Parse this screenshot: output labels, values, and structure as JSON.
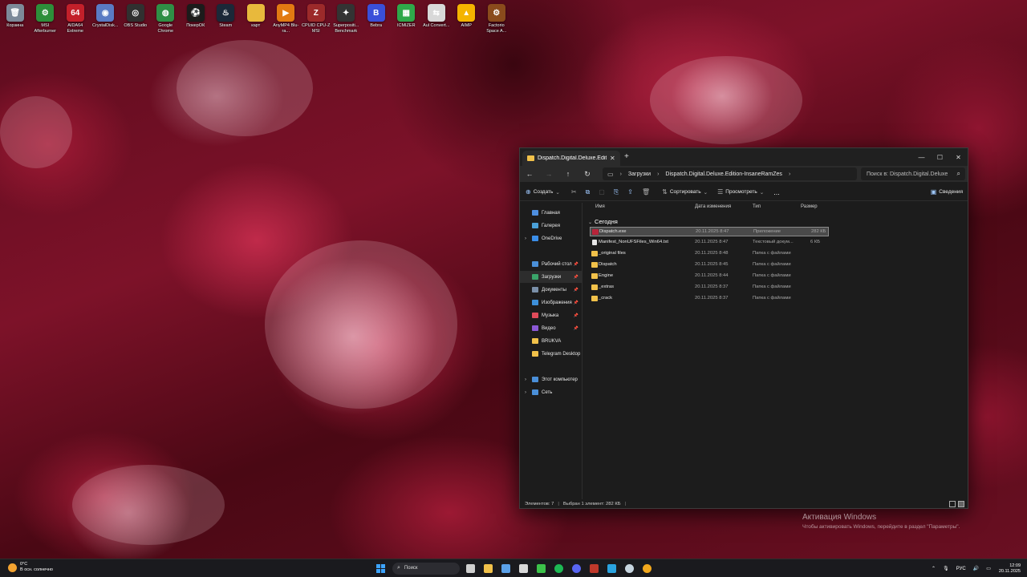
{
  "desktop": {
    "icons": [
      {
        "label": "Корзина",
        "icon": "recycle-bin-icon",
        "color": "#7d8a99",
        "glyph": "🗑"
      },
      {
        "label": "MSI Afterburner",
        "icon": "msi-afterburner-icon",
        "color": "#2d8f3a",
        "glyph": "⚙"
      },
      {
        "label": "AIDA64 Extreme",
        "icon": "aida64-icon",
        "color": "#c3202a",
        "glyph": "64"
      },
      {
        "label": "CrystalDisk...",
        "icon": "crystaldisk-icon",
        "color": "#5a7bc4",
        "glyph": "◉"
      },
      {
        "label": "OBS Studio",
        "icon": "obs-studio-icon",
        "color": "#303030",
        "glyph": "◎"
      },
      {
        "label": "Google Chrome",
        "icon": "chrome-icon",
        "color": "#2f8f46",
        "glyph": "◍"
      },
      {
        "label": "ПокерОК",
        "icon": "pokerok-icon",
        "color": "#1b1b1b",
        "glyph": "⚽"
      },
      {
        "label": "Steam",
        "icon": "steam-icon",
        "color": "#1b2838",
        "glyph": "♨"
      },
      {
        "label": "карт",
        "icon": "folder-icon",
        "color": "#e8b93c",
        "glyph": ""
      },
      {
        "label": "AnyMP4 Blu-ra...",
        "icon": "anymp4-icon",
        "color": "#e27a12",
        "glyph": "▶"
      },
      {
        "label": "CPUID CPU-Z MSI",
        "icon": "cpuz-icon",
        "color": "#9c2a2a",
        "glyph": "Z"
      },
      {
        "label": "Superpositi... Benchmark",
        "icon": "superposition-icon",
        "color": "#333333",
        "glyph": "✦"
      },
      {
        "label": "Bebra",
        "icon": "bebra-icon",
        "color": "#3a4fd9",
        "glyph": "B"
      },
      {
        "label": "ICMIZER",
        "icon": "icmizer-icon",
        "color": "#2fa84a",
        "glyph": "▦"
      },
      {
        "label": "Aul Convert...",
        "icon": "aul-convert-icon",
        "color": "#d8d8d8",
        "glyph": "⇆"
      },
      {
        "label": "AIMP",
        "icon": "aimp-icon",
        "color": "#f4b400",
        "glyph": "▲"
      },
      {
        "label": "Factorio Space A...",
        "icon": "factorio-icon",
        "color": "#8a4b1c",
        "glyph": "⚙"
      }
    ]
  },
  "explorer": {
    "tab_title": "Dispatch.Digital.Deluxe.Edition",
    "breadcrumb": [
      "Загрузки",
      "Dispatch.Digital.Deluxe.Edition-InsaneRamZes"
    ],
    "search_placeholder": "Поиск в: Dispatch.Digital.Deluxe",
    "toolbar": {
      "create": "Создать",
      "sort": "Сортировать",
      "view": "Просмотреть",
      "more": "...",
      "details": "Сведения"
    },
    "sidebar": [
      {
        "label": "Главная",
        "icon": "home-icon",
        "color": "#4e8fe0"
      },
      {
        "label": "Галерея",
        "icon": "gallery-icon",
        "color": "#4aa0d8"
      },
      {
        "label": "OneDrive",
        "icon": "onedrive-icon",
        "color": "#3b8ee8"
      },
      {
        "label": "Рабочий стол",
        "icon": "desktop-icon",
        "color": "#4a8fd8"
      },
      {
        "label": "Загрузки",
        "icon": "downloads-icon",
        "color": "#3aa46a"
      },
      {
        "label": "Документы",
        "icon": "documents-icon",
        "color": "#7a8fa8"
      },
      {
        "label": "Изображения",
        "icon": "pictures-icon",
        "color": "#3d8fd9"
      },
      {
        "label": "Музыка",
        "icon": "music-icon",
        "color": "#e04b5a"
      },
      {
        "label": "Видео",
        "icon": "videos-icon",
        "color": "#8b59d6"
      },
      {
        "label": "BRUKVA",
        "icon": "folder-icon",
        "color": "#f1c14a"
      },
      {
        "label": "Telegram Desktop",
        "icon": "folder-icon",
        "color": "#f1c14a"
      },
      {
        "label": "Этот компьютер",
        "icon": "this-pc-icon",
        "color": "#4a8fd8"
      },
      {
        "label": "Сеть",
        "icon": "network-icon",
        "color": "#4a8fd8"
      }
    ],
    "columns": {
      "name": "Имя",
      "modified": "Дата изменения",
      "type": "Тип",
      "size": "Размер"
    },
    "group": "Сегодня",
    "files": [
      {
        "name": "Dispatch.exe",
        "modified": "20.11.2025 8:47",
        "type": "Приложение",
        "size": "282 КБ",
        "kind": "exe"
      },
      {
        "name": "Manifest_NonUFSFiles_Win64.txt",
        "modified": "20.11.2025 8:47",
        "type": "Текстовый докум...",
        "size": "6 КБ",
        "kind": "txt"
      },
      {
        "name": "_original files",
        "modified": "20.11.2025 8:48",
        "type": "Папка с файлами",
        "size": "",
        "kind": "folder"
      },
      {
        "name": "Dispatch",
        "modified": "20.11.2025 8:45",
        "type": "Папка с файлами",
        "size": "",
        "kind": "folder"
      },
      {
        "name": "Engine",
        "modified": "20.11.2025 8:44",
        "type": "Папка с файлами",
        "size": "",
        "kind": "folder"
      },
      {
        "name": "_extras",
        "modified": "20.11.2025 8:37",
        "type": "Папка с файлами",
        "size": "",
        "kind": "folder"
      },
      {
        "name": "_crack",
        "modified": "20.11.2025 8:37",
        "type": "Папка с файлами",
        "size": "",
        "kind": "folder"
      }
    ],
    "status": {
      "count": "Элементов: 7",
      "selected": "Выбран 1 элемент: 282 КБ"
    }
  },
  "activation": {
    "title": "Активация Windows",
    "subtitle": "Чтобы активировать Windows, перейдите в раздел \"Параметры\"."
  },
  "taskbar": {
    "weather_temp": "0°C",
    "weather_desc": "В осн. солнечно",
    "search_label": "Поиск",
    "apps": [
      {
        "icon": "task-view-icon",
        "color": "#cfcfcf"
      },
      {
        "icon": "file-explorer-icon",
        "color": "#f1c14a"
      },
      {
        "icon": "store-icon",
        "color": "#5aa0e8"
      },
      {
        "icon": "obs-icon",
        "color": "#d8d8d8"
      },
      {
        "icon": "download-app-icon",
        "color": "#3cc24a"
      },
      {
        "icon": "spotify-icon",
        "color": "#1db954"
      },
      {
        "icon": "discord-icon",
        "color": "#5865f2"
      },
      {
        "icon": "media-icon",
        "color": "#c0392b"
      },
      {
        "icon": "telegram-icon",
        "color": "#2aa3e0"
      },
      {
        "icon": "steam-icon",
        "color": "#c7d5e0"
      },
      {
        "icon": "chrome-icon",
        "color": "#f2a81d"
      }
    ],
    "lang": "РУС",
    "time": "12:09",
    "date": "20.11.2025"
  }
}
